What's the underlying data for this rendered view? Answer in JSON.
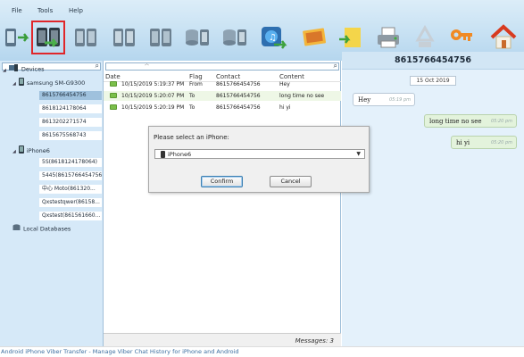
{
  "menu": {
    "file": "File",
    "tools": "Tools",
    "help": "Help"
  },
  "toolbar": [
    {
      "icon": "phone-sync-icon"
    },
    {
      "icon": "transfer-phones-icon"
    },
    {
      "icon": "phone-export-icon"
    },
    {
      "icon": "phone-import-icon"
    },
    {
      "icon": "phone-backup-icon"
    },
    {
      "icon": "database-export-icon"
    },
    {
      "icon": "database-sync-icon"
    },
    {
      "icon": "itunes-icon"
    },
    {
      "icon": "export-image-icon"
    },
    {
      "icon": "export-note-icon"
    },
    {
      "icon": "print-icon"
    },
    {
      "icon": "recycle-icon"
    },
    {
      "icon": "key-icon"
    },
    {
      "icon": "home-icon"
    }
  ],
  "tree": {
    "devices": "Devices",
    "samsung": "samsung SM-G9300",
    "samsung_children": [
      "8615766454756",
      "8618124178064",
      "8613202271574",
      "8615675568743"
    ],
    "iphone": "iPhone6",
    "iphone_children": [
      "5S(8618124178064)",
      "5445(8615766454756)",
      "中心 Moto(861320...",
      "Qxstestqwer(86158...",
      "Qxstest(861561660..."
    ],
    "local": "Local Databases"
  },
  "table": {
    "headers": [
      "Date",
      "Flag",
      "Contact",
      "Content"
    ],
    "rows": [
      {
        "date": "10/15/2019 5:19:37 PM",
        "flag": "From",
        "contact": "8615766454756",
        "content": "Hey"
      },
      {
        "date": "10/15/2019 5:20:07 PM",
        "flag": "To",
        "contact": "8615766454756",
        "content": "long time no see"
      },
      {
        "date": "10/15/2019 5:20:19 PM",
        "flag": "To",
        "contact": "8615766454756",
        "content": "hi yi"
      }
    ],
    "status": "Messages: 3"
  },
  "dialog": {
    "prompt": "Please select an iPhone:",
    "selected": "iPhone6",
    "confirm": "Confirm",
    "cancel": "Cancel"
  },
  "chat": {
    "title": "8615766454756",
    "date": "15 Oct 2019",
    "messages": [
      {
        "dir": "in",
        "text": "Hey",
        "time": "05:19 pm"
      },
      {
        "dir": "out",
        "text": "long time no see",
        "time": "05:20 pm"
      },
      {
        "dir": "out",
        "text": "hi yi",
        "time": "05:20 pm"
      }
    ]
  },
  "footer": "Android iPhone Viber Transfer - Manage Viber Chat History for iPhone and Android",
  "colors": {
    "header": "#c7e1f3",
    "selected_border": "#e0262a",
    "left_panel": "#d6e9f8",
    "outgoing": "#e3f3dc"
  }
}
